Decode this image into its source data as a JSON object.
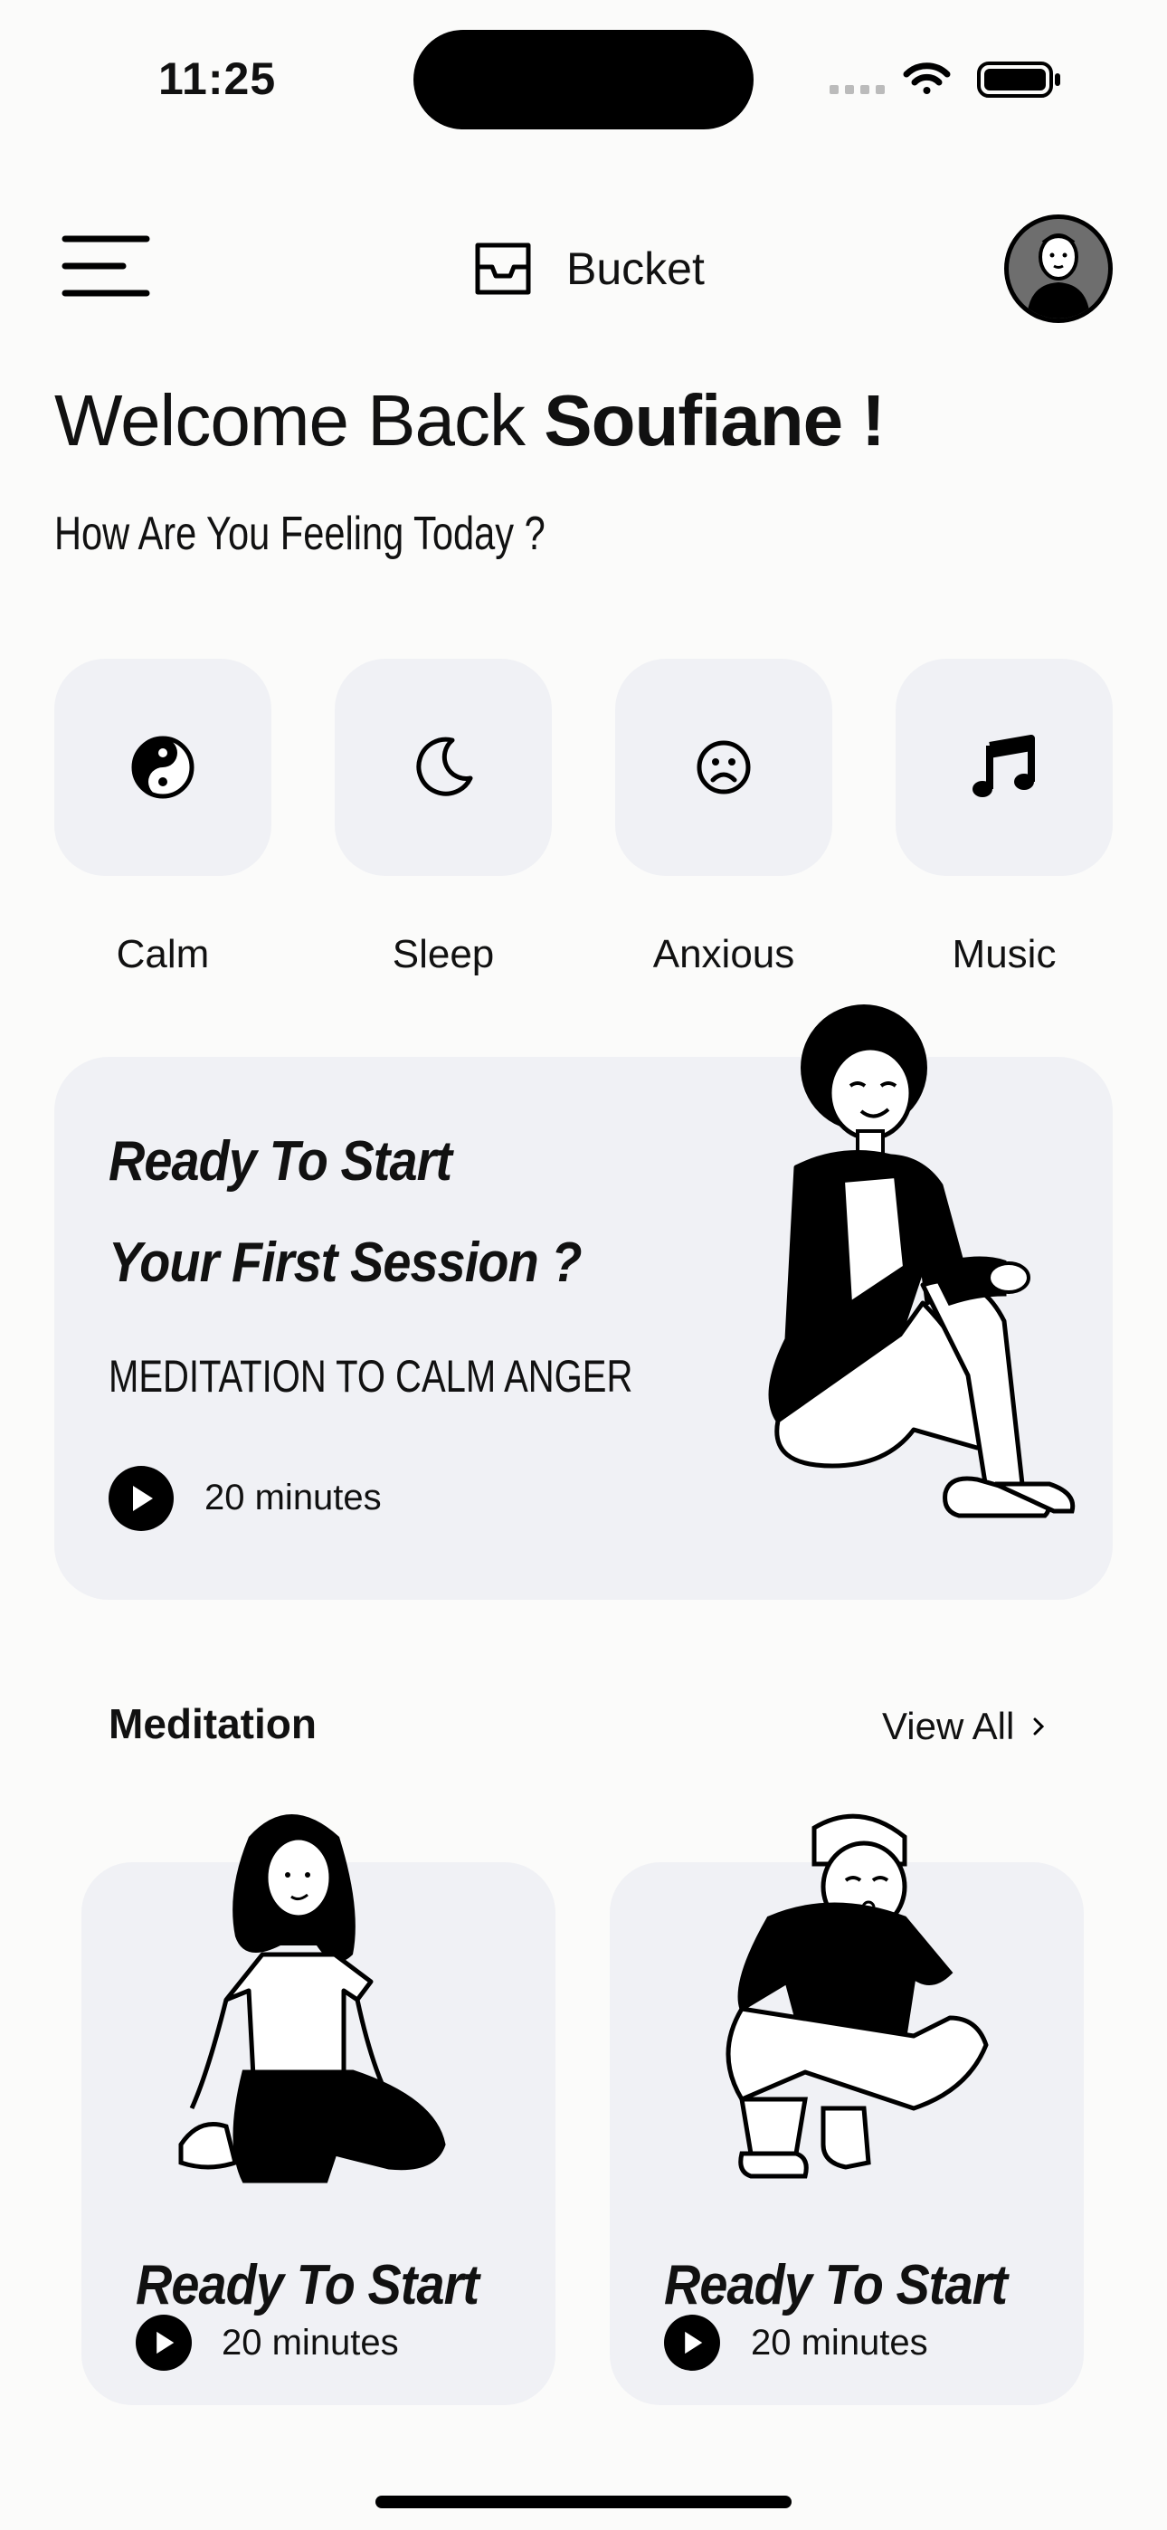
{
  "status_bar": {
    "time": "11:25"
  },
  "header": {
    "title": "Bucket"
  },
  "welcome": {
    "prefix": "Welcome Back ",
    "name": "Soufiane !",
    "subtitle": "How Are You Feeling Today ?"
  },
  "moods": [
    {
      "label": "Calm",
      "icon": "yin-yang-icon"
    },
    {
      "label": "Sleep",
      "icon": "moon-icon"
    },
    {
      "label": "Anxious",
      "icon": "frown-face-icon"
    },
    {
      "label": "Music",
      "icon": "music-note-icon"
    }
  ],
  "session": {
    "title_line1": "Ready To Start",
    "title_line2": "Your First Session ?",
    "subtitle": "MEDITATION TO CALM ANGER",
    "duration": "20 minutes"
  },
  "meditation": {
    "section_title": "Meditation",
    "view_all": "View All",
    "cards": [
      {
        "title": "Ready To Start",
        "duration": "20 minutes"
      },
      {
        "title": "Ready To Start",
        "duration": "20 minutes"
      }
    ]
  },
  "colors": {
    "background": "#fbfbfa",
    "card": "#f0f1f5",
    "ink": "#000000"
  }
}
